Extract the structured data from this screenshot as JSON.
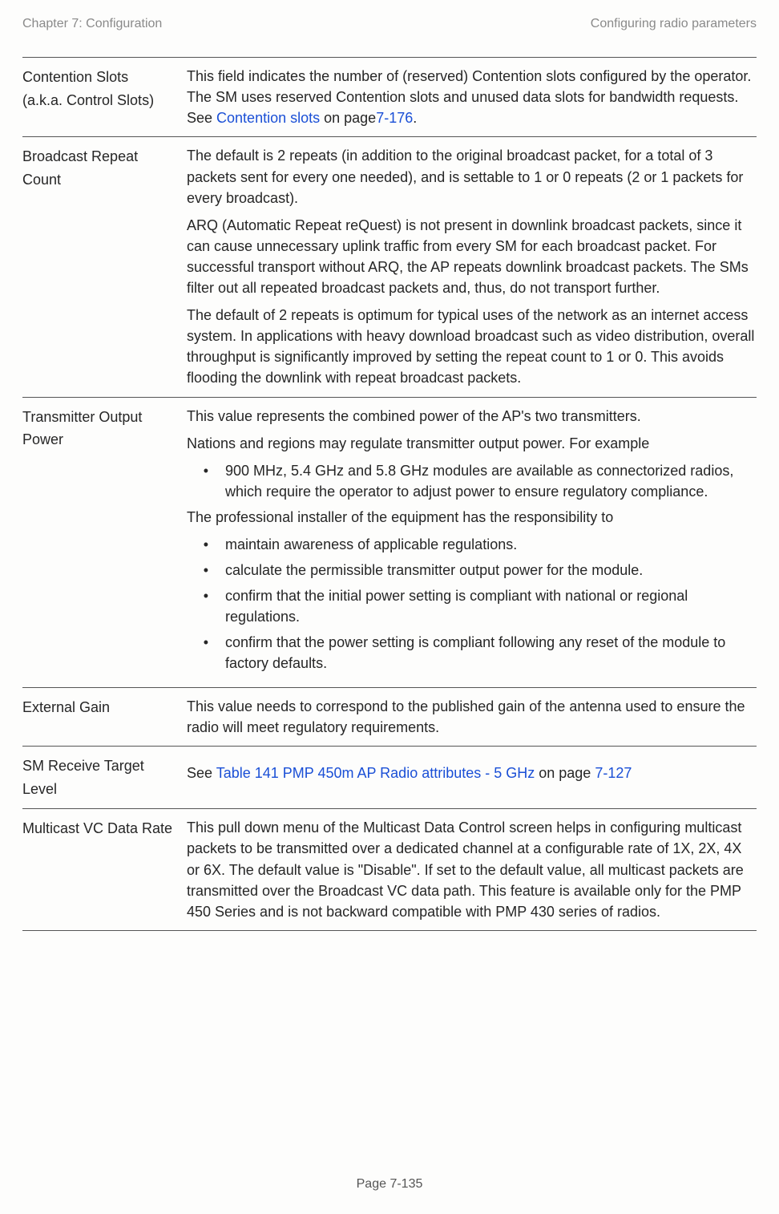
{
  "header": {
    "left": "Chapter 7:  Configuration",
    "right": "Configuring radio parameters"
  },
  "rows": [
    {
      "label_line1": "Contention Slots",
      "label_line2": "(a.k.a. Control Slots)",
      "p1a": "This field indicates the number of (reserved) Contention slots configured by the operator. The SM uses reserved Contention slots and unused data slots for bandwidth requests. See ",
      "link1": "Contention slots",
      "p1b": " on page",
      "link2": "7-176",
      "p1c": "."
    },
    {
      "label": "Broadcast Repeat Count",
      "p1": "The default is 2 repeats (in addition to the original broadcast packet, for a total of 3 packets sent for every one needed), and is settable to 1 or 0 repeats (2 or 1 packets for every broadcast).",
      "p2": "ARQ (Automatic Repeat reQuest) is not present in downlink broadcast packets, since it can cause unnecessary uplink traffic from every SM for each broadcast packet. For successful transport without ARQ, the AP repeats downlink broadcast packets. The SMs filter out all repeated broadcast packets and, thus, do not transport further.",
      "p3": "The default of 2 repeats is optimum for typical uses of the network as an internet access system. In applications with heavy download broadcast such as video distribution, overall throughput is significantly improved by setting the repeat count to 1 or 0. This avoids flooding the downlink with repeat broadcast packets."
    },
    {
      "label": "Transmitter Output Power",
      "p1": "This value represents the combined power of the AP's two transmitters.",
      "p2": "Nations and regions may regulate transmitter output power. For example",
      "b1": "900 MHz, 5.4 GHz and 5.8 GHz modules are available as connectorized radios, which require the operator to adjust power to ensure regulatory compliance.",
      "p3": "The professional installer of the equipment has the responsibility to",
      "b2": "maintain awareness of applicable regulations.",
      "b3": "calculate the permissible transmitter output power for the module.",
      "b4": "confirm that the initial power setting is compliant with national or regional regulations.",
      "b5": "confirm that the power setting is compliant following any reset of the module to factory defaults."
    },
    {
      "label": "External Gain",
      "p1": "This value needs to correspond to the published gain of the antenna used to ensure the radio will meet regulatory requirements."
    },
    {
      "label": "SM Receive Target Level",
      "p1a": "See ",
      "link1": "Table 141 PMP 450m AP Radio attributes - 5 GHz",
      "p1b": " on page ",
      "link2": "7-127"
    },
    {
      "label": "Multicast VC Data Rate",
      "p1": "This pull down menu of the Multicast Data Control screen helps in configuring multicast packets to be transmitted over a dedicated channel at a configurable rate of 1X, 2X, 4X or 6X. The default value is \"Disable\". If set to the default value, all multicast packets are transmitted over the Broadcast VC data path. This feature is available only for the PMP 450 Series and is not backward compatible with PMP 430 series of radios."
    }
  ],
  "footer": "Page 7-135"
}
